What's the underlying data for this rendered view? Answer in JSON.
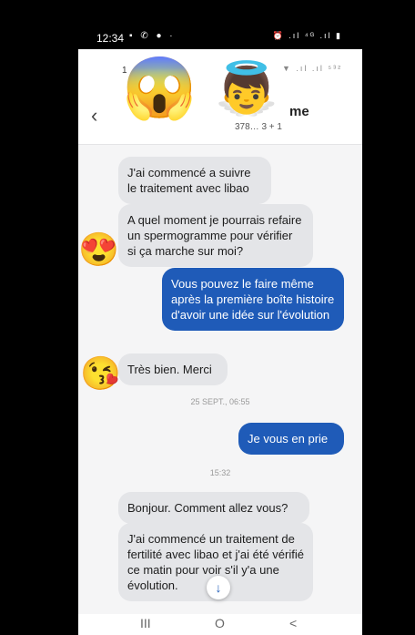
{
  "status_bar": {
    "time": "12:34",
    "left_icons": "▪ ✆ ● ·",
    "right_icons": "⏰ .ıl ⁴ᴳ .ıl ▮"
  },
  "header": {
    "back_icon": "‹",
    "contact_name": "me",
    "contact_sub": "378… 3 + 1",
    "faded_digit": "1",
    "faded_icons": "▼ .ıl .ıl ⁵³²"
  },
  "emojis": {
    "scream": "😱",
    "angel": "👼",
    "heart_eyes": "😍",
    "kiss": "😘"
  },
  "messages": [
    {
      "dir": "in",
      "text": "J'ai commencé a suivre le traitement avec libao"
    },
    {
      "dir": "in",
      "text": "A quel moment je pourrais refaire un spermogramme pour vérifier si ça marche sur moi?"
    },
    {
      "dir": "out",
      "text": "Vous pouvez le faire même après la première boîte histoire d'avoir une idée sur l'évolution"
    },
    {
      "dir": "in",
      "text": "Très bien. Merci"
    },
    {
      "dir": "out",
      "text": "Je vous en prie"
    },
    {
      "dir": "in",
      "text": "Bonjour. Comment allez vous?"
    },
    {
      "dir": "in",
      "text": "J'ai commencé un traitement de fertilité avec libao et j'ai été vérifié ce matin pour voir s'il y'a une évolution."
    }
  ],
  "timestamps": [
    "25 SEPT., 06:55",
    "15:32"
  ],
  "scroll_down_icon": "↓",
  "nav_bar": {
    "recents": "III",
    "home": "O",
    "back": "<"
  }
}
